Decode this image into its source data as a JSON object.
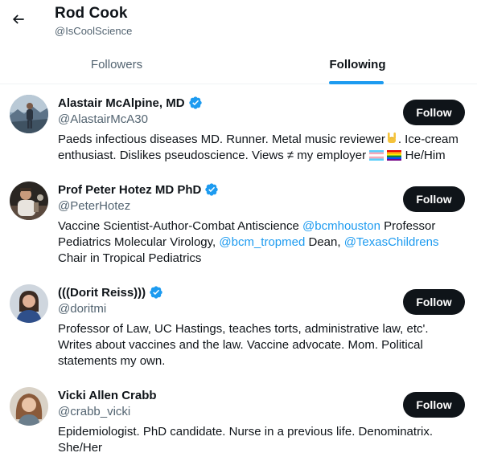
{
  "header": {
    "title": "Rod Cook",
    "handle": "@IsCoolScience"
  },
  "tabs": [
    {
      "label": "Followers",
      "active": false
    },
    {
      "label": "Following",
      "active": true
    }
  ],
  "colors": {
    "accent": "#1d9bf0",
    "button_bg": "#0f1419",
    "secondary_text": "#536471"
  },
  "users": [
    {
      "name": "Alastair McAlpine, MD",
      "verified": true,
      "handle": "@AlastairMcA30",
      "follow_label": "Follow",
      "bio": {
        "line1": "Paeds infectious diseases MD. Runner. Metal music reviewer",
        "line1_end": ". Ice-cream",
        "line2": "enthusiast. Dislikes pseudoscience. Views ≠ my employer",
        "line2_end": "He/Him"
      }
    },
    {
      "name": "Prof Peter Hotez MD PhD",
      "verified": true,
      "handle": "@PeterHotez",
      "follow_label": "Follow",
      "bio": {
        "p1": "Vaccine Scientist-Author-Combat Antiscience ",
        "m1": "@bcmhouston",
        "p2": " Professor",
        "p3": "Pediatrics Molecular Virology, ",
        "m2": "@bcm_tropmed",
        "p4": " Dean, ",
        "m3": "@TexasChildrens",
        "p5": "Chair in Tropical Pediatrics"
      }
    },
    {
      "name": "(((Dorit Reiss)))",
      "verified": true,
      "handle": "@doritmi",
      "follow_label": "Follow",
      "bio": {
        "line1": "Professor of Law, UC Hastings, teaches torts, administrative law, etc'.",
        "line2": "Writes about vaccines and the law. Vaccine advocate. Mom. Political",
        "line3": "statements my own."
      }
    },
    {
      "name": "Vicki Allen Crabb",
      "verified": false,
      "handle": "@crabb_vicki",
      "follow_label": "Follow",
      "bio": {
        "line1": "Epidemiologist. PhD candidate. Nurse in a previous life. Denominatrix.",
        "line2": "She/Her"
      }
    }
  ]
}
